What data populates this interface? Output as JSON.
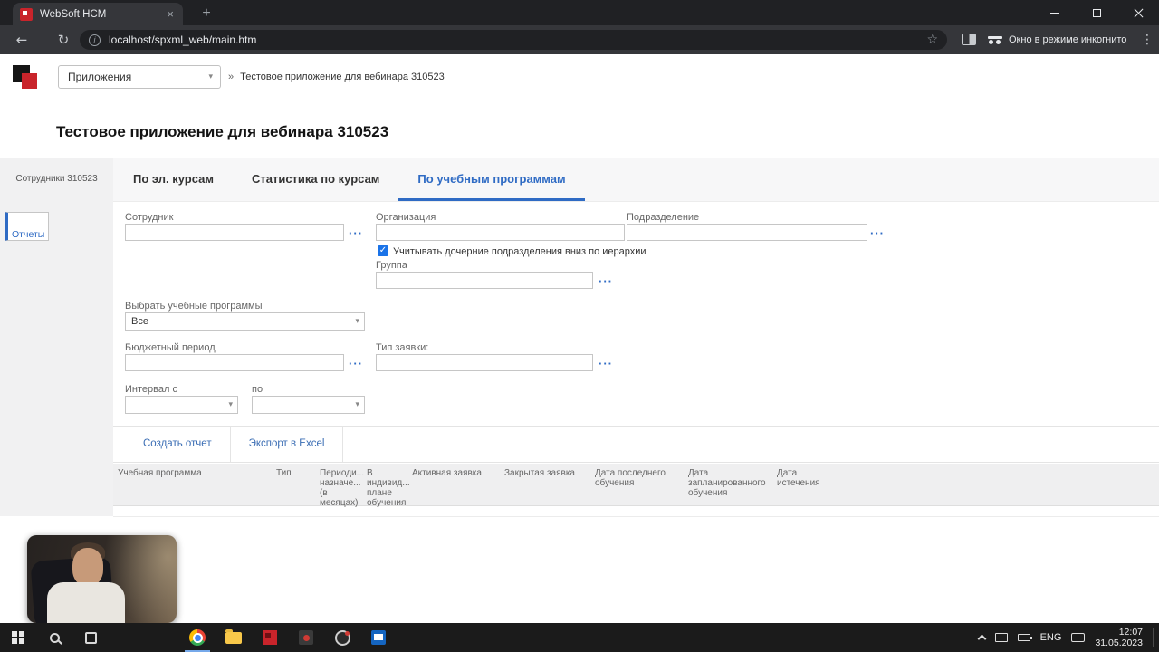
{
  "browser": {
    "tab_title": "WebSoft HCM",
    "url": "localhost/spxml_web/main.htm",
    "incognito_label": "Окно в режиме инкогнито"
  },
  "header": {
    "apps_select": "Приложения",
    "breadcrumb_separator": "»",
    "breadcrumb_current": "Тестовое приложение для вебинара 310523"
  },
  "page": {
    "title": "Тестовое приложение для вебинара 310523"
  },
  "sidebar": {
    "items": [
      {
        "label": "Сотрудники 310523",
        "active": false
      },
      {
        "label": "Отчеты",
        "active": true
      }
    ]
  },
  "tabs": [
    {
      "label": "По эл. курсам",
      "active": false
    },
    {
      "label": "Статистика по курсам",
      "active": false
    },
    {
      "label": "По учебным программам",
      "active": true
    }
  ],
  "filters": {
    "employee": {
      "label": "Сотрудник",
      "value": ""
    },
    "organization": {
      "label": "Организация",
      "value": ""
    },
    "department": {
      "label": "Подразделение",
      "value": ""
    },
    "child_departments_checkbox": {
      "label": "Учитывать дочерние подразделения вниз по иерархии",
      "checked": true
    },
    "group": {
      "label": "Группа",
      "value": ""
    },
    "programs": {
      "label": "Выбрать учебные программы",
      "value": "Все"
    },
    "budget_period": {
      "label": "Бюджетный период",
      "value": ""
    },
    "request_type": {
      "label": "Тип заявки:",
      "value": ""
    },
    "interval_from": {
      "label": "Интервал с",
      "value": ""
    },
    "interval_to": {
      "label": "по",
      "value": ""
    }
  },
  "actions": {
    "create_report": "Создать отчет",
    "export_excel": "Экспорт в Excel"
  },
  "table": {
    "headers": [
      "Учебная программа",
      "Тип",
      "Периоди... назначе... (в месяцах)",
      "В индивид... плане обучения",
      "Активная заявка",
      "Закрытая заявка",
      "Дата последнего обучения",
      "Дата запланированного обучения",
      "Дата истечения"
    ],
    "rows": []
  },
  "colors": {
    "accent_blue": "#2f6bc4",
    "brand_red": "#c9242b"
  },
  "taskbar": {
    "language": "ENG",
    "clock": {
      "time": "12:07",
      "date": "31.05.2023"
    }
  }
}
